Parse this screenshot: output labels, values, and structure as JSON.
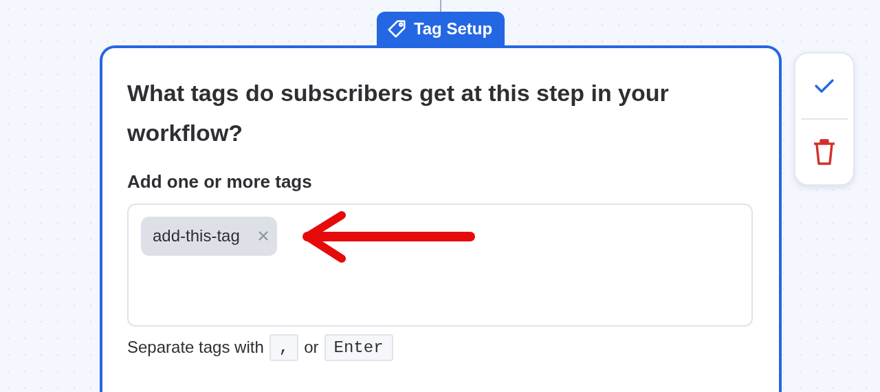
{
  "tab": {
    "label": "Tag Setup"
  },
  "card": {
    "question": "What tags do subscribers get at this step in your workflow?",
    "field_label": "Add one or more tags",
    "tags": [
      {
        "label": "add-this-tag"
      }
    ],
    "hint": {
      "text_before": "Separate tags with",
      "key_1": ",",
      "text_middle": "or",
      "key_2": "Enter"
    }
  },
  "actions": [
    {
      "kind": "confirm"
    },
    {
      "kind": "delete"
    }
  ],
  "annotation": {
    "kind": "arrow"
  }
}
